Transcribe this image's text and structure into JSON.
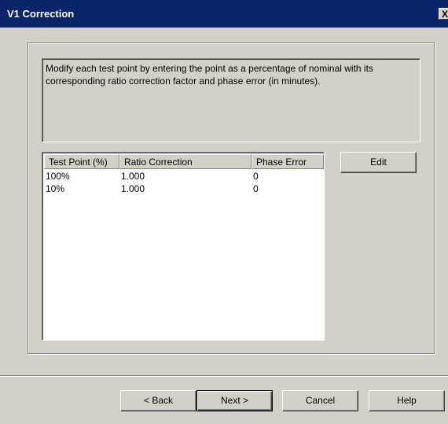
{
  "window": {
    "title": "V1 Correction",
    "close_label": "X"
  },
  "description": "Modify each test point by entering the point as a percentage of nominal with its corresponding ratio correction factor and phase error (in minutes).",
  "table": {
    "columns": [
      "Test Point (%)",
      "Ratio Correction",
      "Phase Error"
    ],
    "rows": [
      [
        "100%",
        "1.000",
        "0"
      ],
      [
        "10%",
        "1.000",
        "0"
      ]
    ]
  },
  "buttons": {
    "edit": "Edit",
    "back": "< Back",
    "next": "Next >",
    "cancel": "Cancel",
    "help": "Help"
  }
}
